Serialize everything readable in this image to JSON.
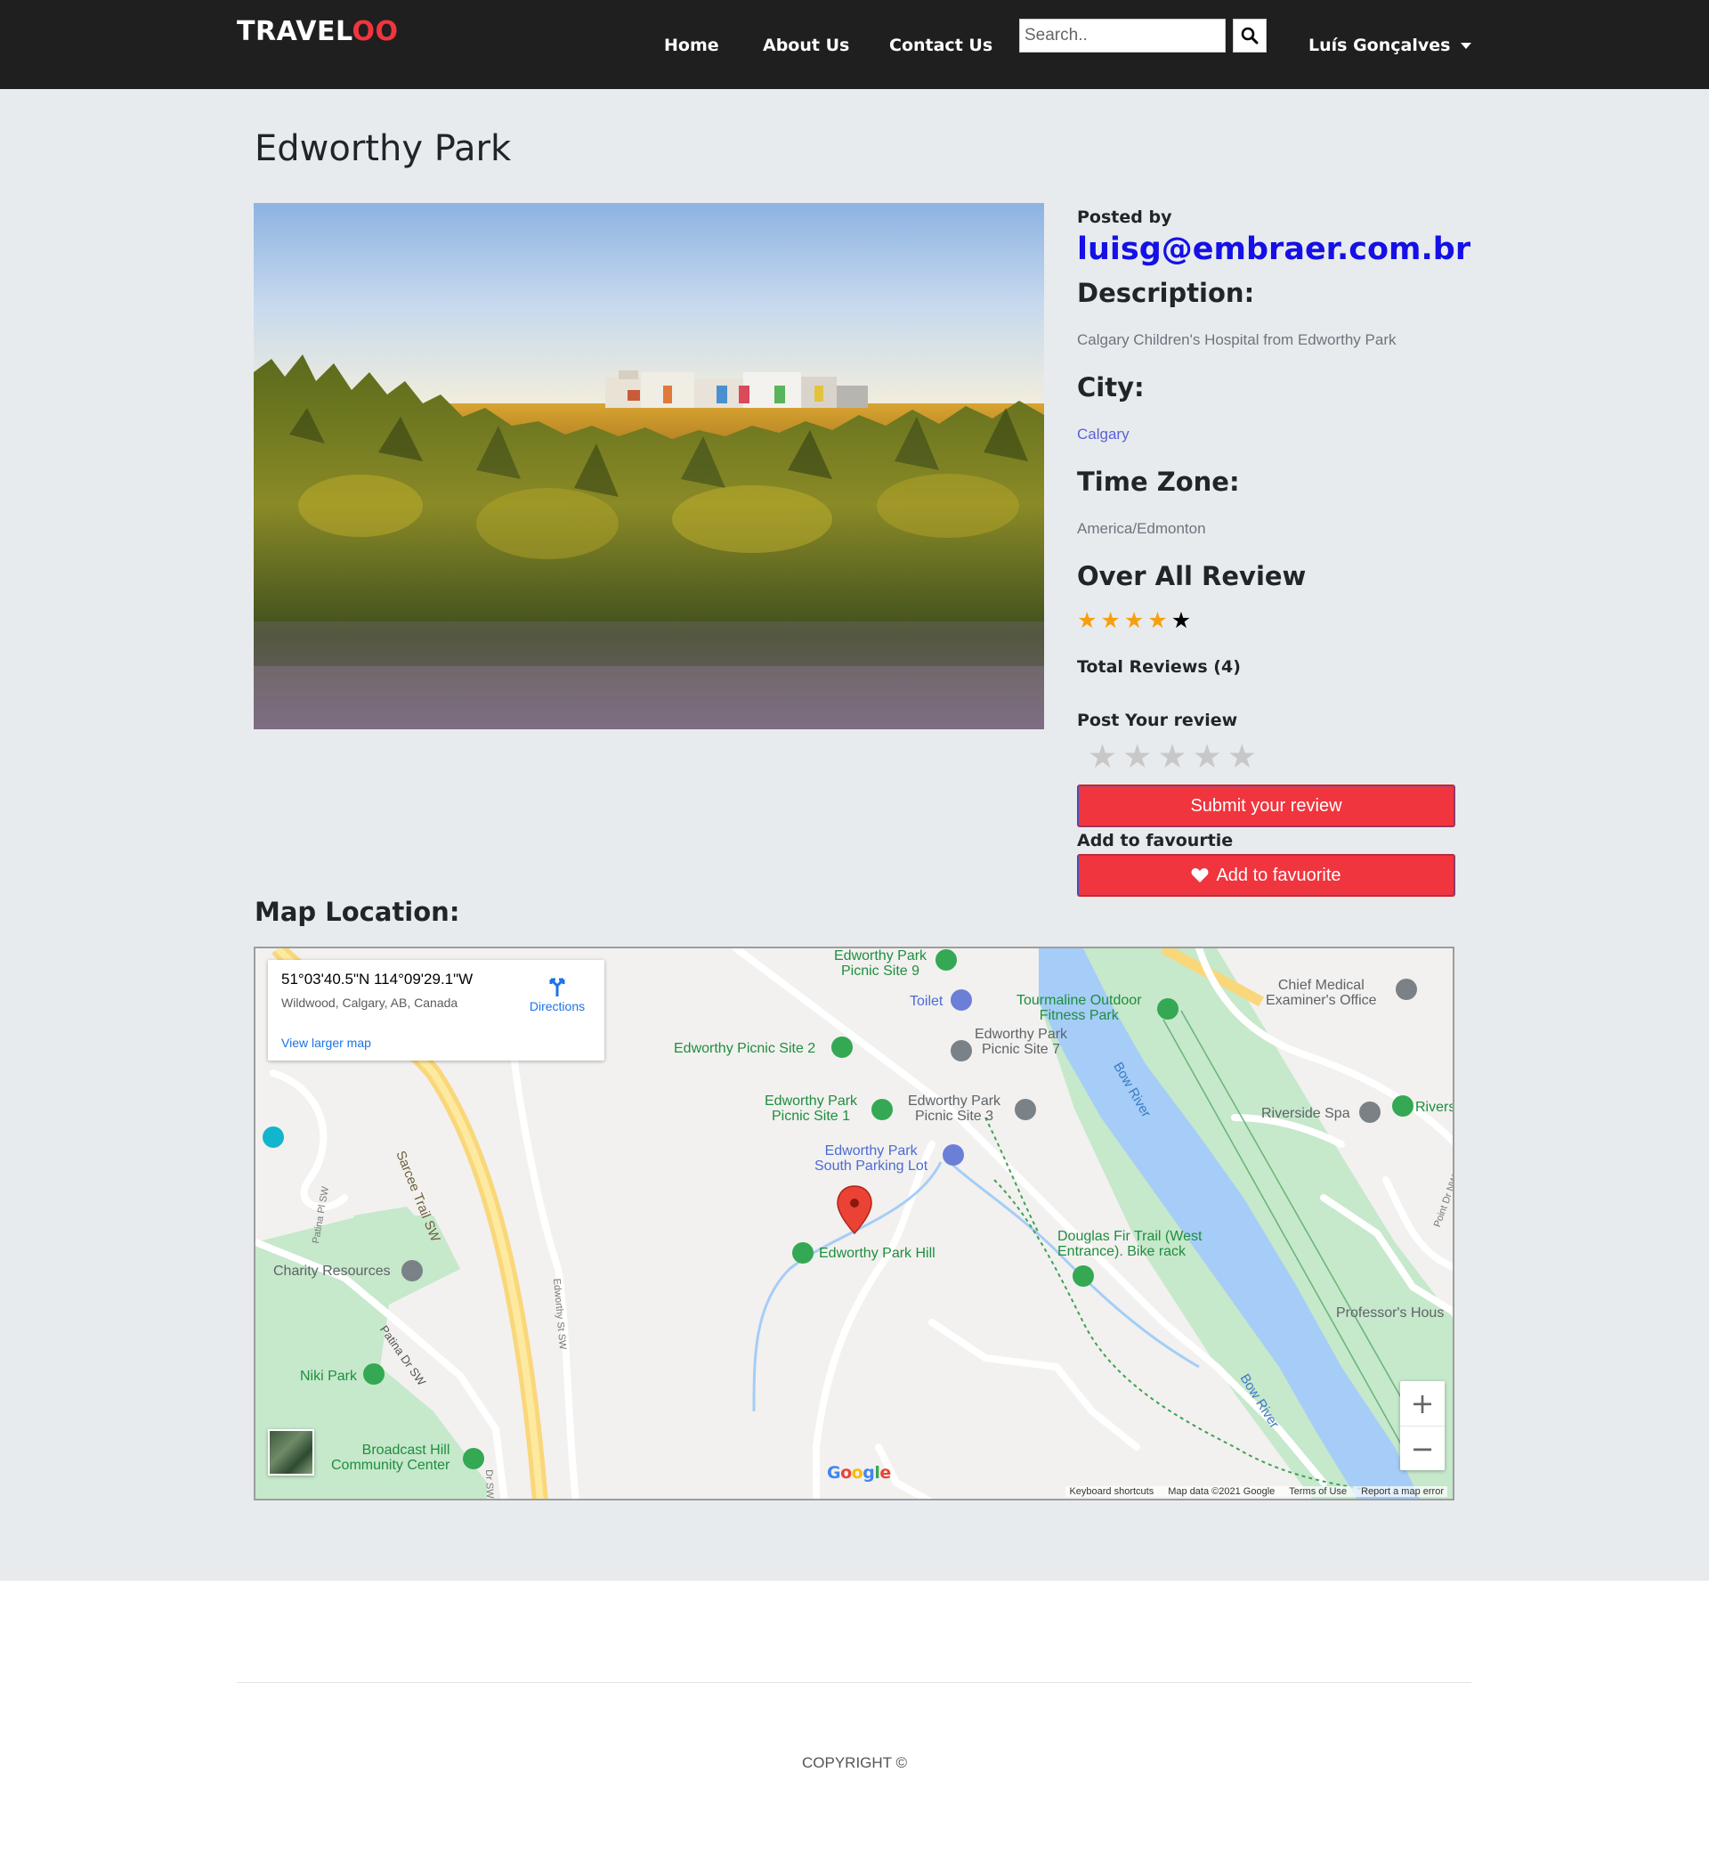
{
  "brand": {
    "part1": "TRAVEL",
    "part2": "OO"
  },
  "nav": {
    "home": "Home",
    "about": "About Us",
    "contact": "Contact Us",
    "search_placeholder": "Search..",
    "user": "Luís Gonçalves"
  },
  "place": {
    "title": "Edworthy Park",
    "posted_by_label": "Posted by",
    "posted_by": "luisg@embraer.com.br",
    "description_label": "Description:",
    "description": "Calgary Children's Hospital from Edworthy Park",
    "city_label": "City:",
    "city": "Calgary",
    "timezone_label": "Time Zone:",
    "timezone": "America/Edmonton",
    "overall_label": "Over All Review",
    "rating": 4,
    "rating_max": 5,
    "total_reviews": "Total Reviews (4)",
    "post_review_label": "Post Your review",
    "submit_review": "Submit your review",
    "fav_label": "Add to favourtie",
    "fav_button": "Add to favuorite"
  },
  "map": {
    "title": "Map Location:",
    "coords": "51°03'40.5\"N 114°09'29.1\"W",
    "address": "Wildwood, Calgary, AB, Canada",
    "directions": "Directions",
    "larger_map": "View larger map",
    "labels": {
      "picnic9": "Edworthy Park\nPicnic Site 9",
      "toilet": "Toilet",
      "tourmaline": "Tourmaline Outdoor\nFitness Park",
      "chief": "Chief Medical\nExaminer's Office",
      "picnic7": "Edworthy Park\nPicnic Site 7",
      "picnic2": "Edworthy Picnic Site 2",
      "picnic1": "Edworthy Park\nPicnic Site 1",
      "picnic3": "Edworthy Park\nPicnic Site 3",
      "riverside": "Riverside Spa",
      "rivers": "Rivers",
      "parking": "Edworthy Park\nSouth Parking Lot",
      "douglas": "Douglas Fir Trail (West\nEntrance). Bike rack",
      "hill": "Edworthy Park Hill",
      "charity": "Charity Resources",
      "professor": "Professor's Hous",
      "niki": "Niki Park",
      "broadcast": "Broadcast Hill\nCommunity Center",
      "sarcee": "Sarcee Trail SW",
      "patina_dr": "Patina Dr SW",
      "patina_pl": "Patina Pl SW",
      "edworthy_st": "Edworthy St SW",
      "bow1": "Bow River",
      "bow2": "Bow River",
      "point_dr": "Point Dr NW",
      "dr_sw": "Dr SW"
    },
    "footer": {
      "shortcuts": "Keyboard shortcuts",
      "mapdata": "Map data ©2021 Google",
      "terms": "Terms of Use",
      "report": "Report a map error"
    },
    "google": "Google"
  },
  "footer": {
    "copyright": "COPYRIGHT ©"
  },
  "colors": {
    "navbar": "#1f1f1f",
    "accent_red": "#f0353e",
    "email_blue": "#1410e6",
    "star": "#f6a00e",
    "page_bg": "#e8ebee"
  }
}
